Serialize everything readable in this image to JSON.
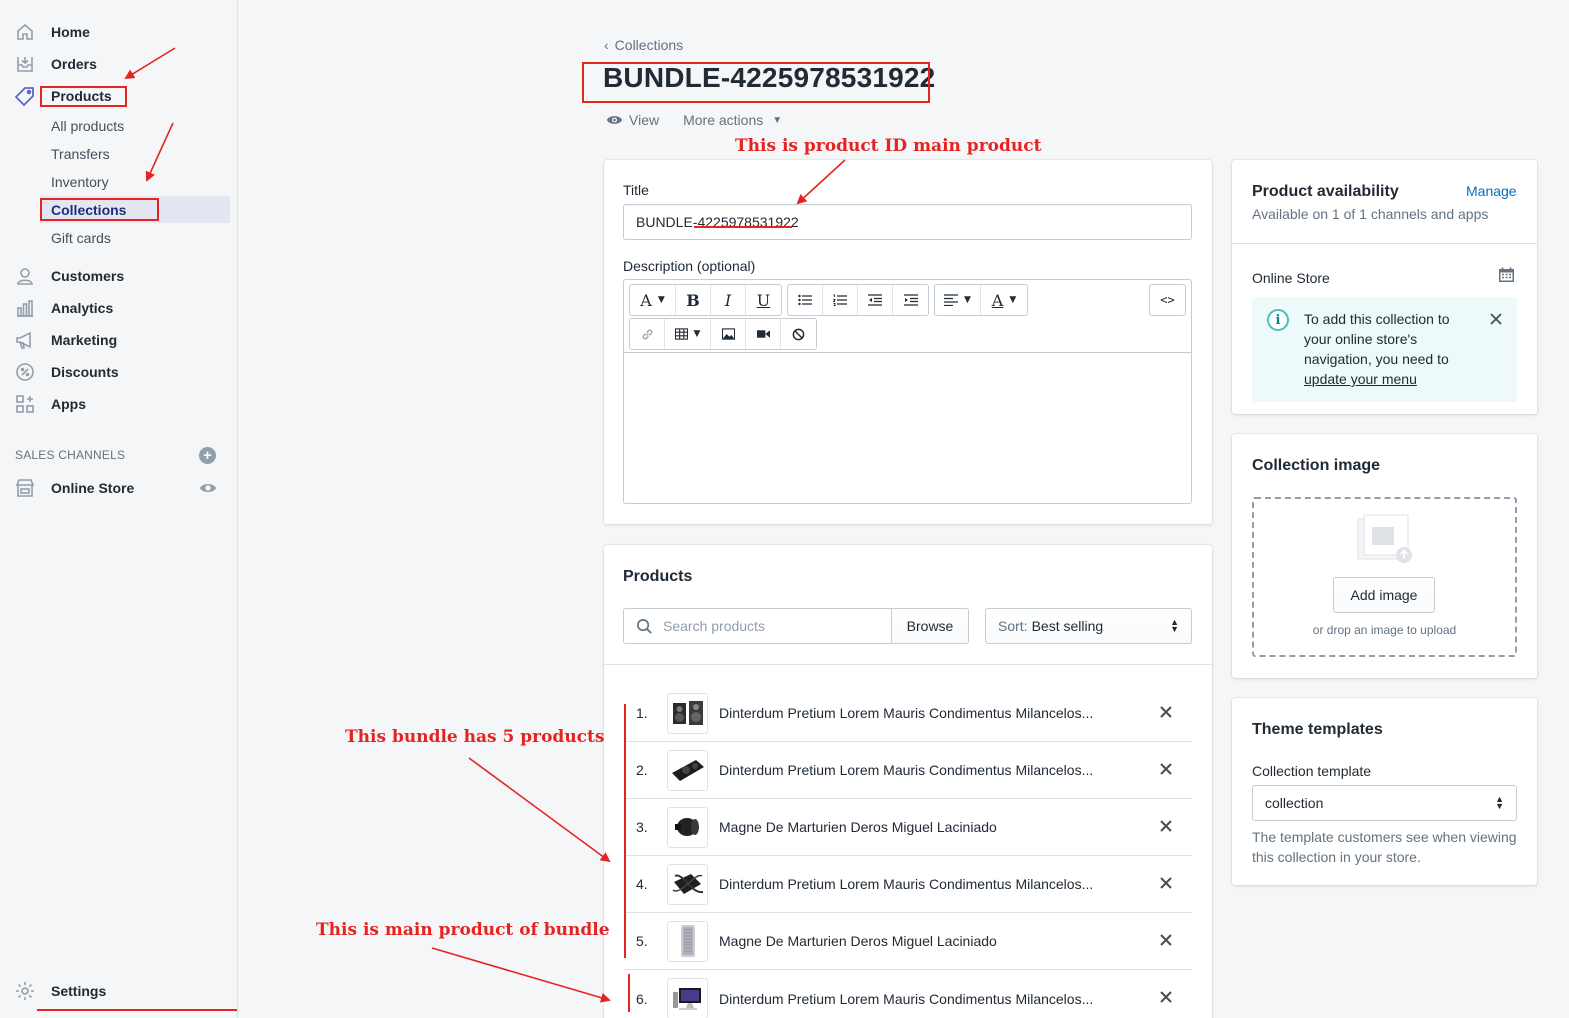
{
  "sidebar": {
    "items": [
      {
        "label": "Home",
        "icon": "home-icon"
      },
      {
        "label": "Orders",
        "icon": "orders-icon"
      },
      {
        "label": "Products",
        "icon": "tag-icon"
      },
      {
        "label": "Customers",
        "icon": "customer-icon"
      },
      {
        "label": "Analytics",
        "icon": "analytics-icon"
      },
      {
        "label": "Marketing",
        "icon": "megaphone-icon"
      },
      {
        "label": "Discounts",
        "icon": "discount-icon"
      },
      {
        "label": "Apps",
        "icon": "apps-icon"
      }
    ],
    "product_sub": [
      "All products",
      "Transfers",
      "Inventory",
      "Collections",
      "Gift cards"
    ],
    "channels_heading": "SALES CHANNELS",
    "online_store": "Online Store",
    "settings": "Settings"
  },
  "header": {
    "back": "Collections",
    "title": "BUNDLE-4225978531922",
    "view": "View",
    "more_actions": "More actions"
  },
  "form": {
    "title_label": "Title",
    "title_value": "BUNDLE-4225978531922",
    "description_label": "Description (optional)"
  },
  "products": {
    "heading": "Products",
    "search_placeholder": "Search products",
    "browse": "Browse",
    "sort_prefix": "Sort:",
    "sort_value": "Best selling",
    "rows": [
      {
        "num": "1.",
        "name": "Dinterdum Pretium Lorem Mauris Condimentus Milancelos..."
      },
      {
        "num": "2.",
        "name": "Dinterdum Pretium Lorem Mauris Condimentus Milancelos..."
      },
      {
        "num": "3.",
        "name": "Magne De Marturien Deros Miguel Laciniado"
      },
      {
        "num": "4.",
        "name": "Dinterdum Pretium Lorem Mauris Condimentus Milancelos..."
      },
      {
        "num": "5.",
        "name": "Magne De Marturien Deros Miguel Laciniado"
      },
      {
        "num": "6.",
        "name": "Dinterdum Pretium Lorem Mauris Condimentus Milancelos..."
      }
    ]
  },
  "availability": {
    "heading": "Product availability",
    "manage": "Manage",
    "summary": "Available on 1 of 1 channels and apps",
    "channel": "Online Store",
    "banner_text": "To add this collection to your online store's navigation, you need to ",
    "banner_link": "update your menu"
  },
  "collection_image": {
    "heading": "Collection image",
    "add_button": "Add image",
    "drop_hint": "or drop an image to upload"
  },
  "theme": {
    "heading": "Theme templates",
    "template_label": "Collection template",
    "template_value": "collection",
    "help": "The template customers see when viewing this collection in your store."
  },
  "annotations": {
    "product_id": "This is product ID main product",
    "bundle_count": "This bundle has 5 products",
    "main_product": "This is main product of bundle"
  },
  "colors": {
    "annotation": "#e52421",
    "link": "#006fbb",
    "banner": "#eef9f9"
  }
}
